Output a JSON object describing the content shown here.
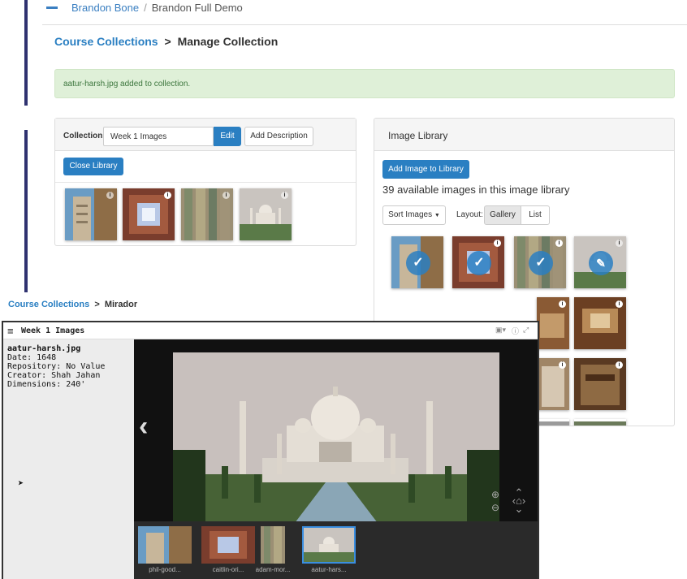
{
  "top_breadcrumb": {
    "first": "Brandon Bone",
    "second": "Brandon Full Demo"
  },
  "header": {
    "parent": "Course Collections",
    "separator": ">",
    "current": "Manage Collection"
  },
  "alert": {
    "message": "aatur-harsh.jpg added to collection."
  },
  "collection_panel": {
    "label": "Collection",
    "name_value": "Week 1 Images",
    "edit_label": "Edit",
    "add_description_label": "Add Description",
    "close_library_label": "Close Library"
  },
  "library_panel": {
    "title": "Image Library",
    "add_button_label": "Add Image to Library",
    "count_text": "39 available images in this image library",
    "sort_label": "Sort Images",
    "layout_label": "Layout:",
    "layout_gallery": "Gallery",
    "layout_list": "List"
  },
  "mirador": {
    "breadcrumb_parent": "Course Collections",
    "breadcrumb_separator": ">",
    "breadcrumb_current": "Mirador",
    "window_title": "Week 1 Images",
    "metadata": {
      "filename": "aatur-harsh.jpg",
      "date": "Date: 1648",
      "repository": "Repository: No Value",
      "creator": "Creator: Shah Jahan",
      "dimensions": "Dimensions: 240'"
    },
    "thumbnails": [
      "phil-good...",
      "caitlin-ori...",
      "adam-mor...",
      "aatur-hars..."
    ]
  },
  "colors": {
    "accent": "#2a7fc2",
    "alert_bg": "#dff0d8",
    "alert_text": "#3c763d",
    "nav_bar": "#2f3270"
  },
  "icons": [
    "hamburger-icon",
    "info-icon",
    "checkmark-icon",
    "chevron-left-icon",
    "zoom-in-icon",
    "zoom-out-icon",
    "pan-arrows-icon",
    "image-icon",
    "expand-icon",
    "mouse-cursor-icon",
    "hand-cursor-icon"
  ]
}
